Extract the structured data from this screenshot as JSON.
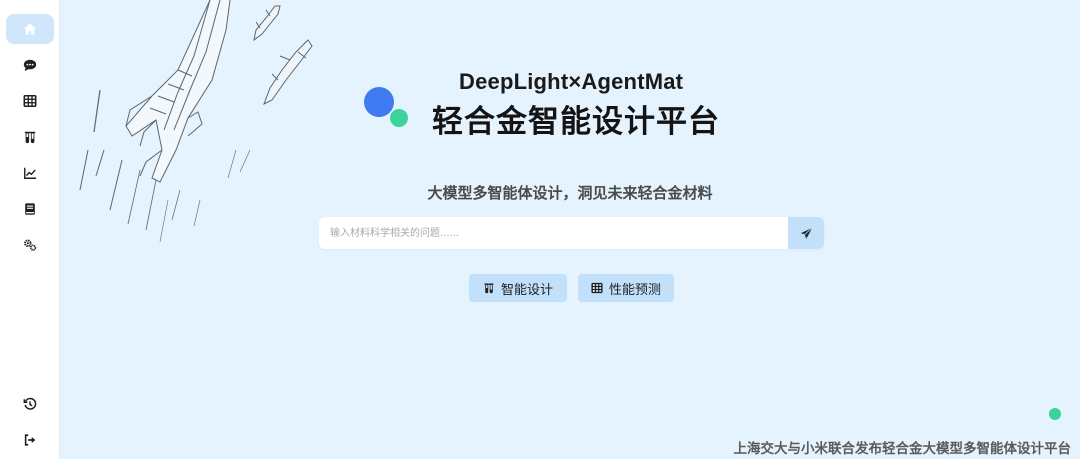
{
  "brand": {
    "title_en": "DeepLight×AgentMat",
    "title_zh": "轻合金智能设计平台",
    "colors": {
      "dot_blue": "#3f7af0",
      "dot_green": "#3bd39a"
    }
  },
  "tagline": "大模型多智能体设计，洞见未来轻合金材料",
  "search": {
    "placeholder": "输入材料科学相关的问题......",
    "value": "",
    "send_icon": "paper-plane-icon"
  },
  "actions": [
    {
      "label": "智能设计",
      "icon": "flask-icon"
    },
    {
      "label": "性能预测",
      "icon": "table-icon"
    }
  ],
  "sidebar": {
    "items": [
      {
        "icon": "home-icon",
        "active": true
      },
      {
        "icon": "chat-icon",
        "active": false
      },
      {
        "icon": "table-icon",
        "active": false
      },
      {
        "icon": "flask-icon",
        "active": false
      },
      {
        "icon": "chart-line-icon",
        "active": false
      },
      {
        "icon": "book-icon",
        "active": false
      },
      {
        "icon": "gears-icon",
        "active": false
      }
    ],
    "bottom_items": [
      {
        "icon": "history-icon"
      },
      {
        "icon": "logout-icon"
      }
    ]
  },
  "footer": "上海交大与小米联合发布轻合金大模型多智能体设计平台",
  "colors": {
    "background": "#e4f3fd",
    "accent_light": "#c3e0fa",
    "active_nav": "#cfe6fb",
    "status_green": "#3bd39a"
  }
}
